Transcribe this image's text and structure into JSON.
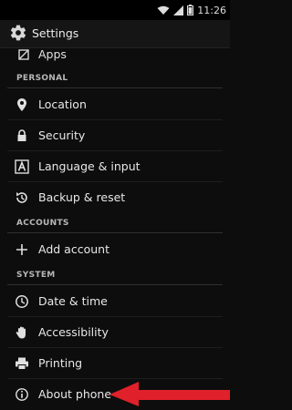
{
  "status_bar": {
    "time": "11:26"
  },
  "action_bar": {
    "title": "Settings"
  },
  "partial_item": {
    "label": "Apps",
    "icon": "apps-icon"
  },
  "sections": {
    "personal": "PERSONAL",
    "accounts": "ACCOUNTS",
    "system": "SYSTEM"
  },
  "items": {
    "location": {
      "label": "Location",
      "icon": "location-pin-icon"
    },
    "security": {
      "label": "Security",
      "icon": "lock-icon"
    },
    "language": {
      "label": "Language & input",
      "icon": "keyboard-letter-icon"
    },
    "backup": {
      "label": "Backup & reset",
      "icon": "backup-restore-icon"
    },
    "add_account": {
      "label": "Add account",
      "icon": "plus-icon"
    },
    "date_time": {
      "label": "Date & time",
      "icon": "clock-icon"
    },
    "accessibility": {
      "label": "Accessibility",
      "icon": "hand-icon"
    },
    "printing": {
      "label": "Printing",
      "icon": "printer-icon"
    },
    "about": {
      "label": "About phone",
      "icon": "info-icon"
    }
  },
  "annotation": {
    "arrow_color": "#e0202a"
  },
  "colors": {
    "background": "#0d0d0d",
    "text": "#e8e8e8",
    "section_title": "#b8b8b8"
  }
}
